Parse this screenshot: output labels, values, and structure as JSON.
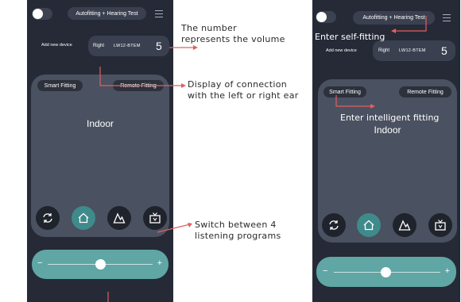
{
  "app": {
    "header_button": "Autofitting + Hearing Test",
    "add_device": "Add new device",
    "device": {
      "side": "Right",
      "model": "LW12-BTEM",
      "volume": "5"
    },
    "chips": {
      "smart": "Smart Fitting",
      "remote": "Remote Fitting"
    },
    "program_name": "Indoor",
    "programs": [
      {
        "icon": "refresh-icon"
      },
      {
        "icon": "home-icon",
        "active": true
      },
      {
        "icon": "mountain-icon"
      },
      {
        "icon": "tv-icon"
      }
    ],
    "volume_slider": {
      "minus": "−",
      "plus": "+",
      "level": 0.42
    }
  },
  "annotations": {
    "volume_note_line1": "The number",
    "volume_note_line2": "represents the volume",
    "connection_note_line1": "Display of connection",
    "connection_note_line2": "with the left or right ear",
    "programs_note_line1": "Switch between 4",
    "programs_note_line2": "listening programs",
    "self_fitting": "Enter self-fitting",
    "intelligent_fitting": "Enter intelligent fitting"
  },
  "colors": {
    "phone_bg": "#252a36",
    "panel_bg": "#4a5161",
    "accent": "#5fa6a5",
    "active_program": "#3f8a8b",
    "annotation_red": "#e06060"
  }
}
